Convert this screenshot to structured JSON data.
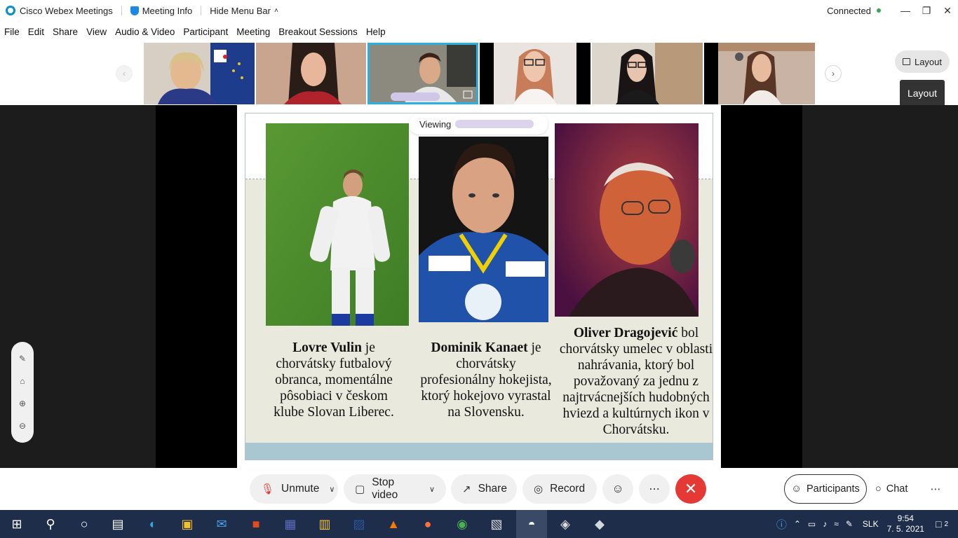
{
  "titlebar": {
    "app_title": "Cisco Webex Meetings",
    "meeting_info": "Meeting Info",
    "hide_menu_bar": "Hide Menu Bar",
    "status": "Connected",
    "status_color": "#3ba55c"
  },
  "menu": [
    "File",
    "Edit",
    "Share",
    "View",
    "Audio & Video",
    "Participant",
    "Meeting",
    "Breakout Sessions",
    "Help"
  ],
  "strip": {
    "layout_label": "Layout",
    "layout_tooltip": "Layout"
  },
  "viewing": {
    "prefix": "Viewing"
  },
  "slide": {
    "people": [
      {
        "name": "Lovre Vulin",
        "text": " je chorvátsky futbalový obranca, momentálne pôsobiaci v českom klube Slovan Liberec."
      },
      {
        "name": "Dominik Kanaet",
        "text": " je chorvátsky profesionálny hokejista, ktorý hokejovo vyrastal na Slovensku."
      },
      {
        "name": "Oliver Dragojević",
        "text": " bol chorvátsky umelec v oblasti nahrávania, ktorý bol považovaný za jednu z najtrvácnejších hudobných hviezd a kultúrnych ikon v Chorvátsku."
      }
    ]
  },
  "controls": {
    "unmute": "Unmute",
    "stop_video": "Stop video",
    "share": "Share",
    "record": "Record",
    "participants": "Participants",
    "chat": "Chat",
    "end_color": "#e53935"
  },
  "taskbar": {
    "lang": "SLK",
    "time": "9:54",
    "date": "7. 5. 2021",
    "notifications": "2"
  }
}
